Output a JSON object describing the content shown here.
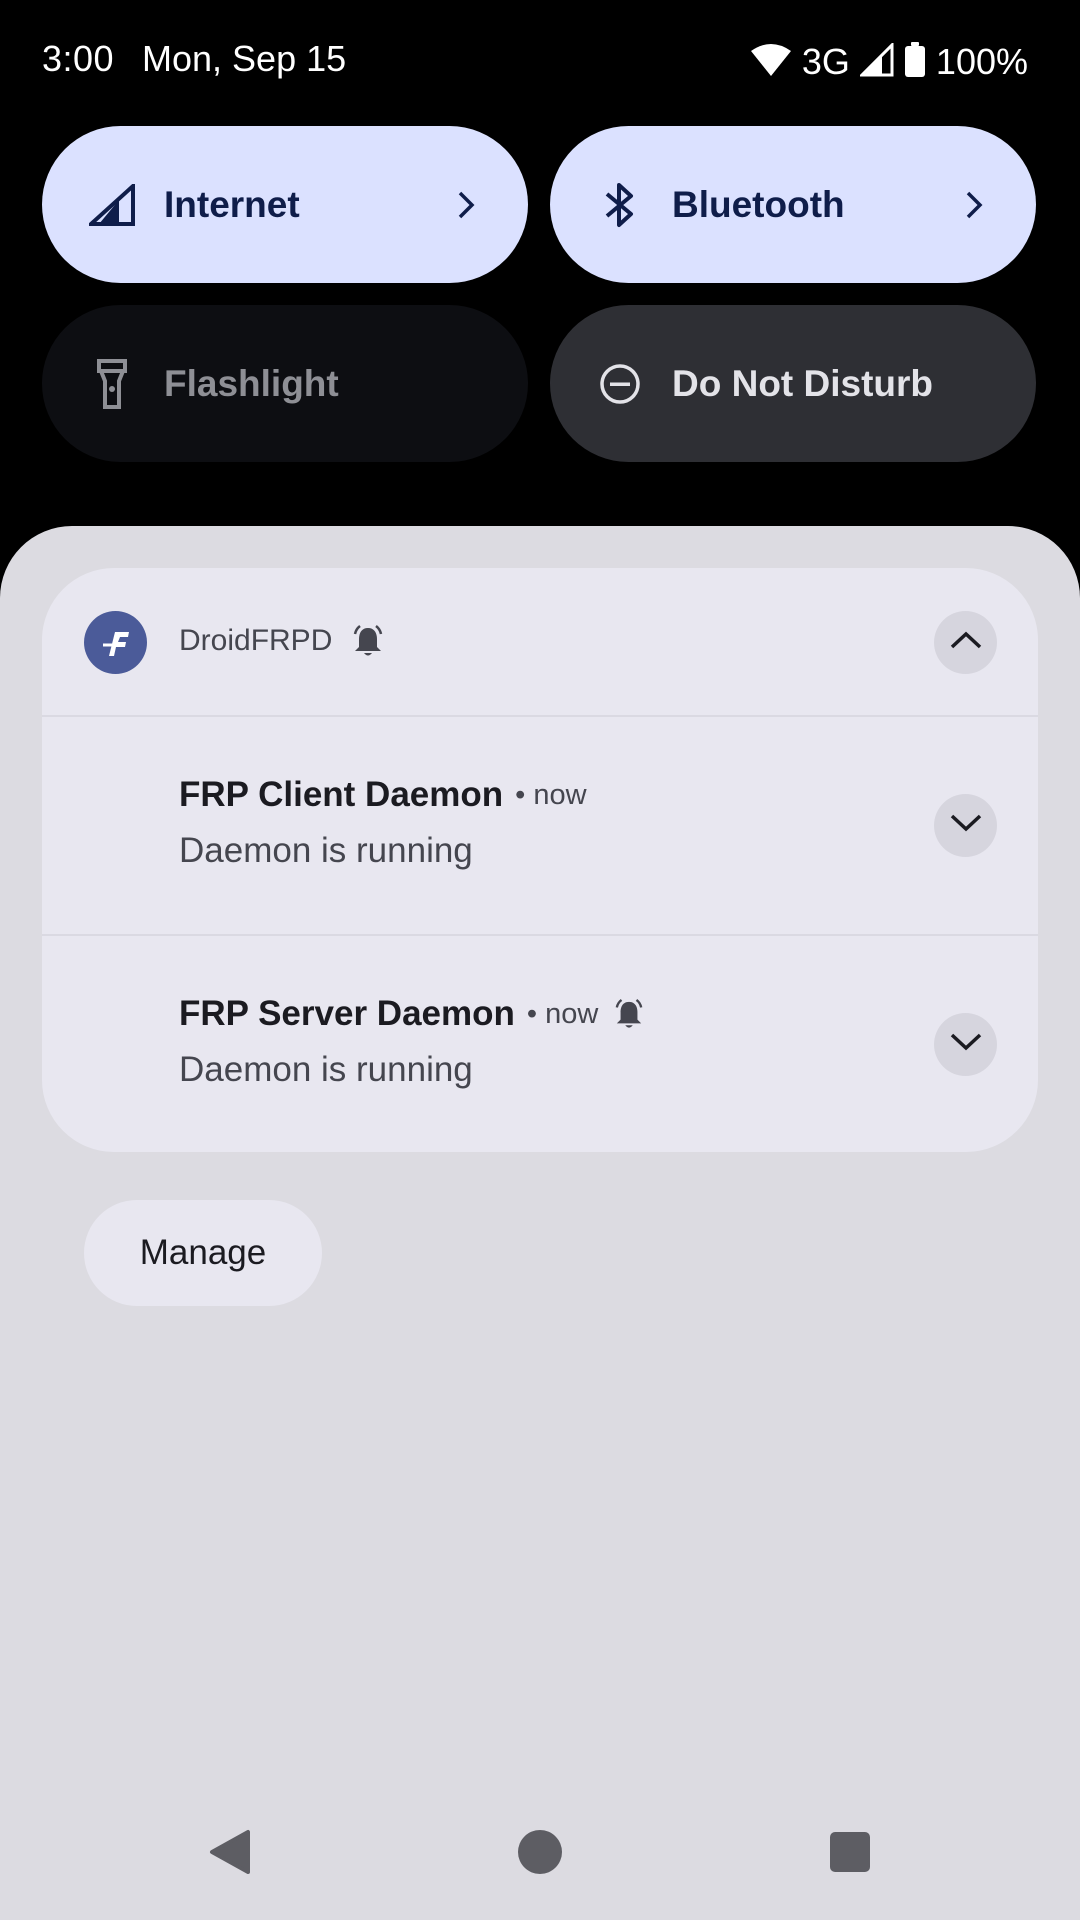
{
  "status_bar": {
    "time": "3:00",
    "date": "Mon, Sep 15",
    "network_type": "3G",
    "battery": "100%",
    "icons": [
      "wifi-icon",
      "cell-signal-icon",
      "battery-icon"
    ]
  },
  "quick_tiles": [
    {
      "label": "Internet",
      "icon": "cell-signal-icon",
      "state": "on",
      "has_chevron": true
    },
    {
      "label": "Bluetooth",
      "icon": "bluetooth-icon",
      "state": "on",
      "has_chevron": true
    },
    {
      "label": "Flashlight",
      "icon": "flashlight-icon",
      "state": "unavailable",
      "has_chevron": false
    },
    {
      "label": "Do Not Disturb",
      "icon": "do-not-disturb-icon",
      "state": "off",
      "has_chevron": false
    }
  ],
  "notification_group": {
    "app_name": "DroidFRPD",
    "app_icon": "droidfrpd-app-icon",
    "expanded": true,
    "items": [
      {
        "title": "FRP Client Daemon",
        "time": "• now",
        "text": "Daemon is running",
        "alerted": false
      },
      {
        "title": "FRP Server Daemon",
        "time": "• now",
        "text": "Daemon is running",
        "alerted": true
      }
    ]
  },
  "manage_label": "Manage",
  "nav_bar": {
    "buttons": [
      "back-icon",
      "home-icon",
      "recents-icon"
    ]
  },
  "colors": {
    "tile_on_bg": "#dbe1ff",
    "tile_off_bg": "#2e2f34",
    "shade_bg": "#dcdbe1",
    "card_bg": "#e8e7f0",
    "app_icon_bg": "#4b5b99"
  }
}
